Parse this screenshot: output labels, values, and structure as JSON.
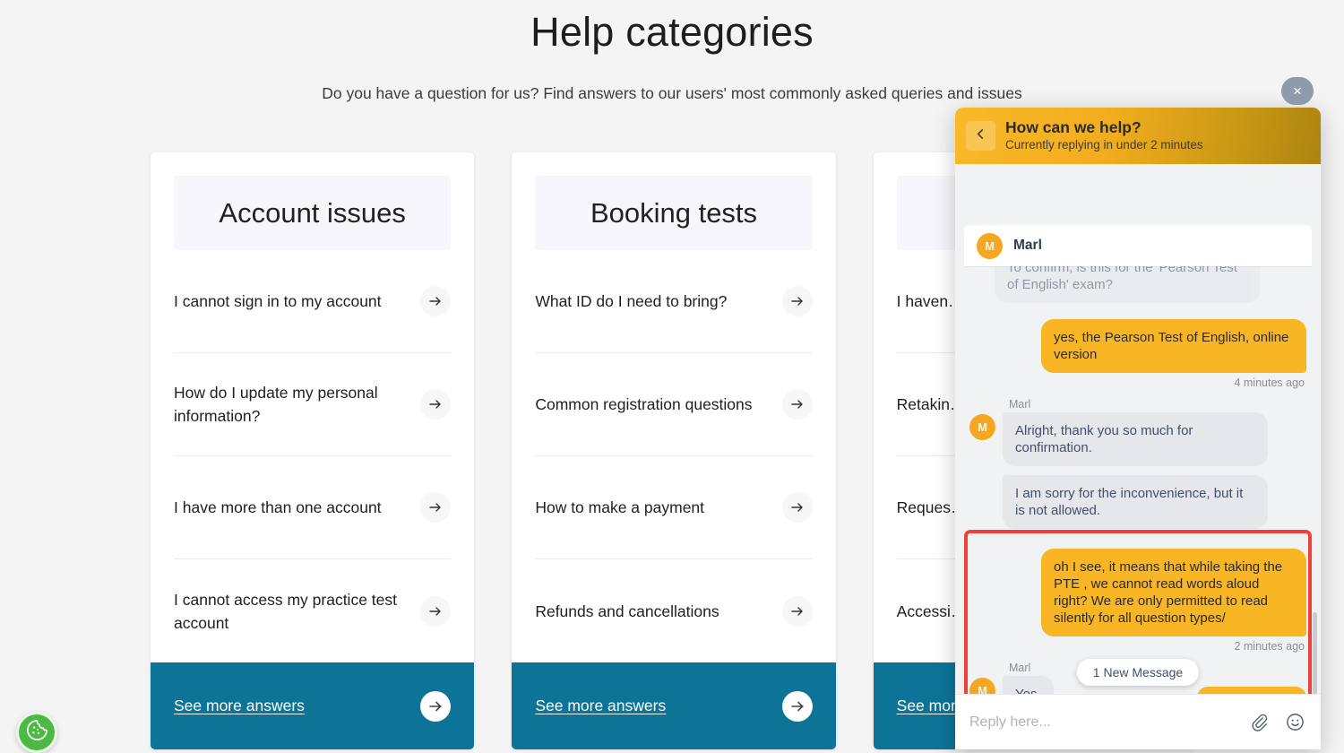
{
  "page": {
    "title": "Help categories",
    "subtitle": "Do you have a question for us? Find answers to our users' most commonly asked queries and issues",
    "accent_teal": "#0d7498",
    "accent_yellow": "#f8b624",
    "highlight_red": "#ef4136",
    "cookie_green": "#4cb944"
  },
  "cards": [
    {
      "title": "Account issues",
      "items": [
        "I cannot sign in to my account",
        "How do I update my personal information?",
        "I have more than one account",
        "I cannot access my practice test account"
      ],
      "footer_label": "See more answers"
    },
    {
      "title": "Booking tests",
      "items": [
        "What ID do I need to bring?",
        "Common registration questions",
        "How to make a payment",
        "Refunds and cancellations"
      ],
      "footer_label": "See more answers"
    },
    {
      "title": "",
      "items": [
        "I haven… score/r…",
        "Retakin…",
        "Reques…",
        "Accessi… score"
      ],
      "footer_label": "See mor"
    }
  ],
  "chat": {
    "close_label": "×",
    "header": {
      "title": "How can we help?",
      "subtitle": "Currently replying in under 2 minutes",
      "back_icon": "chevron-left-icon"
    },
    "agent_bar": {
      "avatar_initial": "M",
      "name": "Marl"
    },
    "messages": [
      {
        "id": "m1",
        "direction": "in",
        "text": "To confirm, is this for the 'Pearson Test of English' exam?",
        "partially_scrolled": true,
        "sender": "Marl"
      },
      {
        "id": "m2",
        "direction": "out",
        "text": "yes, the Pearson Test of English, online version",
        "timestamp": "4 minutes ago"
      },
      {
        "id": "m3",
        "direction": "in",
        "sender": "Marl",
        "text": "Alright, thank you so much for confirmation."
      },
      {
        "id": "m4",
        "direction": "in",
        "text": "I am sorry for the inconvenience, but it is not allowed."
      },
      {
        "id": "m5",
        "direction": "out",
        "text": "oh I see, it means that while taking the PTE , we cannot read words aloud right? We are only permitted to read silently for all question types/",
        "timestamp": "2 minutes ago",
        "highlighted": true
      },
      {
        "id": "m6",
        "direction": "in",
        "sender": "Marl",
        "text": "Yes.",
        "highlighted": true
      }
    ],
    "new_message_pill": "1 New Message",
    "footer": {
      "placeholder": "Reply here...",
      "attach_icon": "paperclip-icon",
      "emoji_icon": "smiley-icon"
    }
  },
  "cookie_widget": {
    "icon": "cookie-icon"
  }
}
